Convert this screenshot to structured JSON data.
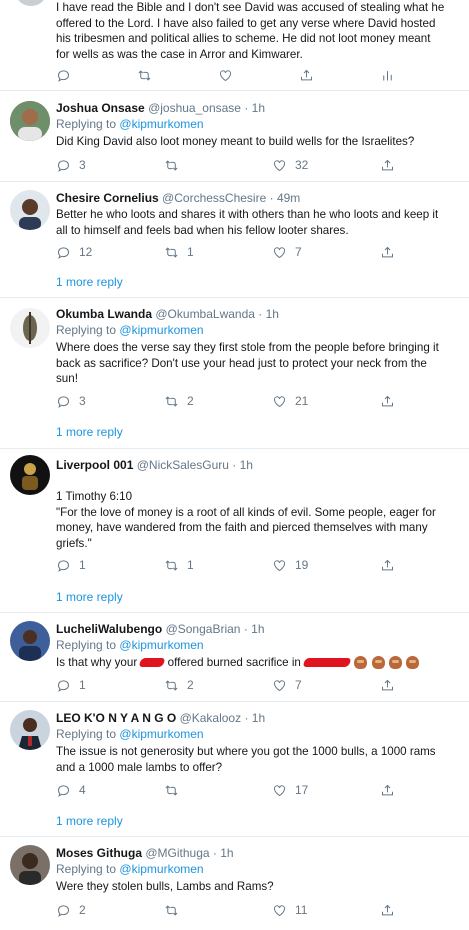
{
  "top_tweet": {
    "lines": [
      "I have read the Bible and I don't see David was accused of stealing what he",
      "offered to the Lord. I have also failed to get any verse where David hosted",
      "his tribesmen and political allies to scheme. He did not loot money meant",
      "for wells as was the case in Arror and Kimwarer."
    ]
  },
  "replies": [
    {
      "name": "Joshua Onsase",
      "handle": "@joshua_onsase",
      "time": "· 1h",
      "replying_prefix": "Replying to",
      "replying_to": "@kipmurkomen",
      "lines": [
        "Did King David also loot money meant to build wells for the Israelites?"
      ],
      "reply_count": "3",
      "retweet_count": "",
      "like_count": "32",
      "more_replies": ""
    },
    {
      "name": "Chesire Cornelius",
      "handle": "@CorchessChesire",
      "time": "· 49m",
      "replying_prefix": "",
      "replying_to": "",
      "lines": [
        "Better he who loots and shares it with  others than he who loots and keep it",
        "all to himself and feels bad when his fellow looter shares."
      ],
      "reply_count": "12",
      "retweet_count": "1",
      "like_count": "7",
      "more_replies": "1 more reply"
    },
    {
      "name": "Okumba Lwanda",
      "handle": "@OkumbaLwanda",
      "time": "· 1h",
      "replying_prefix": "Replying to",
      "replying_to": "@kipmurkomen",
      "lines": [
        "Where does the verse say they first stole from the people before bringing it",
        "back as sacrifice? Don't use your head just to protect your neck from the",
        "sun!"
      ],
      "reply_count": "3",
      "retweet_count": "2",
      "like_count": "21",
      "more_replies": "1 more reply"
    },
    {
      "name": "Liverpool 001",
      "handle": "@NickSalesGuru",
      "time": "· 1h",
      "replying_prefix": "",
      "replying_to": "",
      "lines": [
        "1 Timothy 6:10",
        "\"For the love of money is a root of all kinds of evil. Some people, eager for",
        "money, have wandered from the faith and pierced themselves with many",
        "griefs.\""
      ],
      "reply_count": "1",
      "retweet_count": "1",
      "like_count": "19",
      "more_replies": "1 more reply"
    },
    {
      "name": "LucheliWalubengo",
      "handle": "@SongaBrian",
      "time": "· 1h",
      "replying_prefix": "Replying to",
      "replying_to": "@kipmurkomen",
      "line_a": "Is that why your",
      "line_b": "offered burned sacrifice in",
      "reply_count": "1",
      "retweet_count": "2",
      "like_count": "7",
      "more_replies": ""
    },
    {
      "name": "LEO K'O N Y A N G O",
      "handle": "@Kakalooz",
      "time": "· 1h",
      "replying_prefix": "Replying to",
      "replying_to": "@kipmurkomen",
      "lines": [
        "The issue is not generosity but where you got the 1000 bulls, a 1000 rams",
        "and a 1000 male lambs to offer?"
      ],
      "reply_count": "4",
      "retweet_count": "",
      "like_count": "17",
      "more_replies": "1 more reply"
    },
    {
      "name": "Moses Githuga",
      "handle": "@MGithuga",
      "time": "· 1h",
      "replying_prefix": "Replying to",
      "replying_to": "@kipmurkomen",
      "lines": [
        "Were they stolen bulls, Lambs and Rams?"
      ],
      "reply_count": "2",
      "retweet_count": "",
      "like_count": "11",
      "more_replies": ""
    }
  ],
  "icons": {
    "reply": "reply-icon",
    "retweet": "retweet-icon",
    "like": "heart-icon",
    "share": "share-icon",
    "analytics": "analytics-icon"
  },
  "colors": {
    "link": "#1b95e0",
    "secondary": "#657786",
    "divider": "#e6ecf0",
    "redaction": "#e0141e"
  }
}
